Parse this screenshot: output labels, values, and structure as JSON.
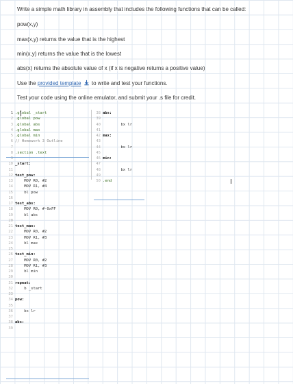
{
  "instructions": {
    "intro": "Write a simple math library in assembly that includes the following functions that can be called:",
    "functions": [
      "pow(x,y)",
      "max(x,y) returns the value that is the highest",
      "min(x,y) returns the value that is the lowest",
      "abs(x) returns the absolute value of x (if x is negative returns a positive value)"
    ],
    "use_before": "Use the",
    "template_link": "provided template",
    "use_after": "to write and test your functions.",
    "test_note": "Test your code using the online emulator, and submit your .s file for credit.",
    "download_icon": "download-icon"
  },
  "code_left": [
    {
      "n": "1",
      "t": ".global _start",
      "c": "kw"
    },
    {
      "n": "2",
      "t": ".global pow",
      "c": "kw"
    },
    {
      "n": "3",
      "t": ".global abs",
      "c": "kw"
    },
    {
      "n": "4",
      "t": ".global max",
      "c": "kw"
    },
    {
      "n": "5",
      "t": ".global min",
      "c": "kw"
    },
    {
      "n": "6",
      "t": "// Homework 3 Outline",
      "c": "cmt"
    },
    {
      "n": "7",
      "t": "",
      "c": ""
    },
    {
      "n": "8",
      "t": ".section .text",
      "c": "kw"
    },
    {
      "n": "9",
      "t": "",
      "c": ""
    },
    {
      "n": "10",
      "t": "_start:",
      "c": "lbl"
    },
    {
      "n": "11",
      "t": "",
      "c": ""
    },
    {
      "n": "12",
      "t": "test_pow:",
      "c": "lbl"
    },
    {
      "n": "13",
      "t": "    MOV R0, #2",
      "c": ""
    },
    {
      "n": "14",
      "t": "    MOV R1, #4",
      "c": ""
    },
    {
      "n": "15",
      "t": "    bl pow",
      "c": ""
    },
    {
      "n": "16",
      "t": "",
      "c": ""
    },
    {
      "n": "17",
      "t": "test_abs:",
      "c": "lbl"
    },
    {
      "n": "18",
      "t": "    MOV R0, #-0xFF",
      "c": ""
    },
    {
      "n": "19",
      "t": "    bl abs",
      "c": ""
    },
    {
      "n": "20",
      "t": "",
      "c": ""
    },
    {
      "n": "21",
      "t": "test_max:",
      "c": "lbl"
    },
    {
      "n": "22",
      "t": "    MOV R0, #2",
      "c": ""
    },
    {
      "n": "23",
      "t": "    MOV R1, #3",
      "c": ""
    },
    {
      "n": "24",
      "t": "    bl max",
      "c": ""
    },
    {
      "n": "25",
      "t": "",
      "c": ""
    },
    {
      "n": "26",
      "t": "test_min:",
      "c": "lbl"
    },
    {
      "n": "27",
      "t": "    MOV R0, #2",
      "c": ""
    },
    {
      "n": "28",
      "t": "    MOV R1, #3",
      "c": ""
    },
    {
      "n": "29",
      "t": "    bl min",
      "c": ""
    },
    {
      "n": "30",
      "t": "",
      "c": ""
    },
    {
      "n": "31",
      "t": "repeat:",
      "c": "lbl"
    },
    {
      "n": "32",
      "t": "    b _start",
      "c": ""
    },
    {
      "n": "33",
      "t": "",
      "c": ""
    },
    {
      "n": "34",
      "t": "pow:",
      "c": "lbl"
    },
    {
      "n": "35",
      "t": "",
      "c": ""
    },
    {
      "n": "36",
      "t": "    bx lr",
      "c": ""
    },
    {
      "n": "37",
      "t": "",
      "c": ""
    },
    {
      "n": "38",
      "t": "abs:",
      "c": "lbl"
    },
    {
      "n": "39",
      "t": "",
      "c": ""
    }
  ],
  "code_right": [
    {
      "n": "38",
      "t": "abs:",
      "c": "lbl"
    },
    {
      "n": "39",
      "t": "",
      "c": ""
    },
    {
      "n": "40",
      "t": "        bx lr",
      "c": ""
    },
    {
      "n": "41",
      "t": "",
      "c": ""
    },
    {
      "n": "42",
      "t": "max:",
      "c": "lbl"
    },
    {
      "n": "43",
      "t": "",
      "c": ""
    },
    {
      "n": "44",
      "t": "        bx lr",
      "c": ""
    },
    {
      "n": "45",
      "t": "",
      "c": ""
    },
    {
      "n": "46",
      "t": "min:",
      "c": "lbl"
    },
    {
      "n": "47",
      "t": "",
      "c": ""
    },
    {
      "n": "48",
      "t": "        bx lr",
      "c": ""
    },
    {
      "n": "49",
      "t": "",
      "c": ""
    },
    {
      "n": "50",
      "t": ".end",
      "c": "kw"
    }
  ]
}
